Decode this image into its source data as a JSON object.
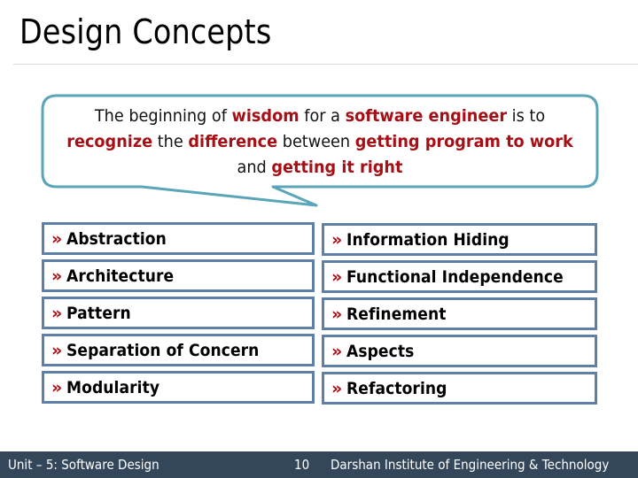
{
  "slide": {
    "title": "Design Concepts"
  },
  "quote": {
    "segments": [
      {
        "text": "The beginning of ",
        "highlight": false
      },
      {
        "text": "wisdom",
        "highlight": true
      },
      {
        "text": " for a ",
        "highlight": false
      },
      {
        "text": "software engineer",
        "highlight": true
      },
      {
        "text": " is to ",
        "highlight": false
      },
      {
        "text": "recognize",
        "highlight": true
      },
      {
        "text": " the ",
        "highlight": false
      },
      {
        "text": "difference",
        "highlight": true
      },
      {
        "text": " between ",
        "highlight": false
      },
      {
        "text": "getting program to work",
        "highlight": true
      },
      {
        "text": " and ",
        "highlight": false
      },
      {
        "text": "getting it right",
        "highlight": true
      }
    ]
  },
  "concepts": {
    "bullet": "»",
    "left": [
      "Abstraction",
      "Architecture",
      "Pattern",
      "Separation of Concern",
      "Modularity"
    ],
    "right": [
      "Information Hiding",
      "Functional Independence",
      "Refinement",
      "Aspects",
      "Refactoring"
    ]
  },
  "footer": {
    "unit": "Unit – 5: Software Design",
    "page_number": "10",
    "institute": "Darshan Institute of Engineering & Technology"
  },
  "colors": {
    "highlight": "#a50f15",
    "bubble_border": "#5aa5b8",
    "box_border": "#5e80a8",
    "footer_bg": "#34475a"
  }
}
